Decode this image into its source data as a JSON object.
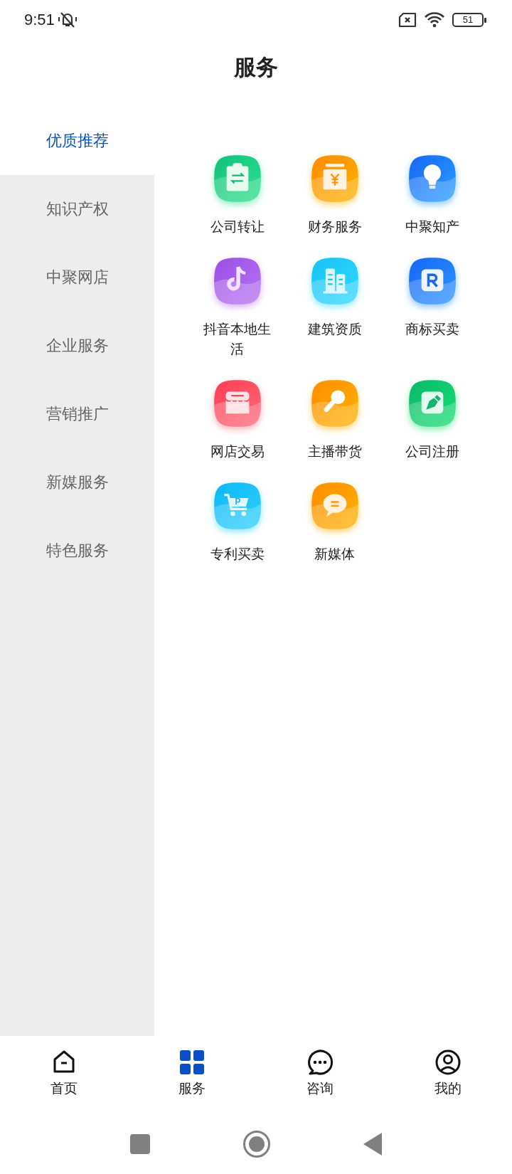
{
  "status_bar": {
    "time": "9:51",
    "battery": "51"
  },
  "header": {
    "title": "服务"
  },
  "sidebar": {
    "items": [
      {
        "label": "优质推荐",
        "selected": true
      },
      {
        "label": "知识产权",
        "selected": false
      },
      {
        "label": "中聚网店",
        "selected": false
      },
      {
        "label": "企业服务",
        "selected": false
      },
      {
        "label": "营销推广",
        "selected": false
      },
      {
        "label": "新媒服务",
        "selected": false
      },
      {
        "label": "特色服务",
        "selected": false
      }
    ]
  },
  "services": [
    {
      "label": "公司转让"
    },
    {
      "label": "财务服务"
    },
    {
      "label": "中聚知产"
    },
    {
      "label": "抖音本地生活"
    },
    {
      "label": "建筑资质"
    },
    {
      "label": "商标买卖"
    },
    {
      "label": "网店交易"
    },
    {
      "label": "主播带货"
    },
    {
      "label": "公司注册"
    },
    {
      "label": "专利买卖",
      "icon_text": "P"
    },
    {
      "label": "新媒体"
    }
  ],
  "tab_bar": [
    {
      "label": "首页",
      "kind": "home",
      "selected": false
    },
    {
      "label": "服务",
      "kind": "grid",
      "selected": true
    },
    {
      "label": "咨询",
      "kind": "chat",
      "selected": false
    },
    {
      "label": "我的",
      "kind": "profile",
      "selected": false
    }
  ]
}
